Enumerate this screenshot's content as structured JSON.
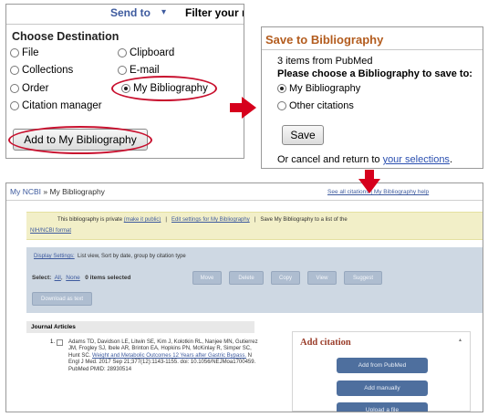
{
  "send_panel": {
    "send_to": "Send to",
    "send_caret": "▾",
    "filter": "Filter your results:",
    "choose_destination": "Choose Destination",
    "options": [
      {
        "label": "File",
        "checked": false
      },
      {
        "label": "Clipboard",
        "checked": false
      },
      {
        "label": "Collections",
        "checked": false
      },
      {
        "label": "E-mail",
        "checked": false
      },
      {
        "label": "Order",
        "checked": false
      },
      {
        "label": "My Bibliography",
        "checked": true
      },
      {
        "label": "Citation manager",
        "checked": false
      }
    ],
    "add_button": "Add to My Bibliography"
  },
  "save_panel": {
    "title": "Save to Bibliography",
    "count": "3 items from PubMed",
    "prompt": "Please choose a Bibliography to save to:",
    "options": [
      {
        "label": "My Bibliography",
        "checked": true
      },
      {
        "label": "Other citations",
        "checked": false
      }
    ],
    "save_button": "Save",
    "cancel_prefix": "Or cancel and return to ",
    "cancel_link": "your selections",
    "cancel_suffix": "."
  },
  "bibliography_panel": {
    "breadcrumb_root": "My NCBI",
    "breadcrumb_sep": " » ",
    "breadcrumb_page": "My Bibliography",
    "top_links": "See all citations | My Bibliography help",
    "notice_1": "This bibliography is private",
    "notice_make_public": "(make it public)",
    "notice_sep": "|",
    "notice_edit": "Edit settings for My Bibliography",
    "notice_save": "Save My Bibliography to a list of the",
    "notice_2": "NIH/NCBI format",
    "display_link": "Display Settings:",
    "display_rest": "List view, Sort by date, group by citation type",
    "select_label": "Select:",
    "select_all": "All",
    "select_none": "None",
    "selected": "0 items selected",
    "toolbar_buttons": [
      "Move",
      "Delete",
      "Copy",
      "View",
      "Suggest"
    ],
    "download_button": "Download as text",
    "articles_heading": "Journal Articles",
    "entry_number": "1.",
    "entry_text": "Adams TD, Davidson LE, Litwin SE, Kim J, Kolotkin RL, Nanjee MN, Gutierrez JM, Frogley SJ, Ibele AR, Brinton EA, Hopkins PN, McKinlay R, Simper SC, Hunt SC.",
    "entry_link": "Weight and Metabolic Outcomes 12 Years after Gastric Bypass.",
    "entry_citation": "N Engl J Med. 2017 Sep 21;377(12):1143-1155. doi: 10.1056/NEJMoa1700459. PubMed PMID: 28930514",
    "add_citation_title": "Add citation",
    "add_caret": "▴",
    "add_buttons": [
      "Add from PubMed",
      "Add manually",
      "Upload a file"
    ]
  },
  "colors": {
    "highlight_red": "#c8102e",
    "arrow_red": "#d6001c",
    "title_orange": "#b35c1e",
    "link_blue": "#3d5a9e"
  }
}
